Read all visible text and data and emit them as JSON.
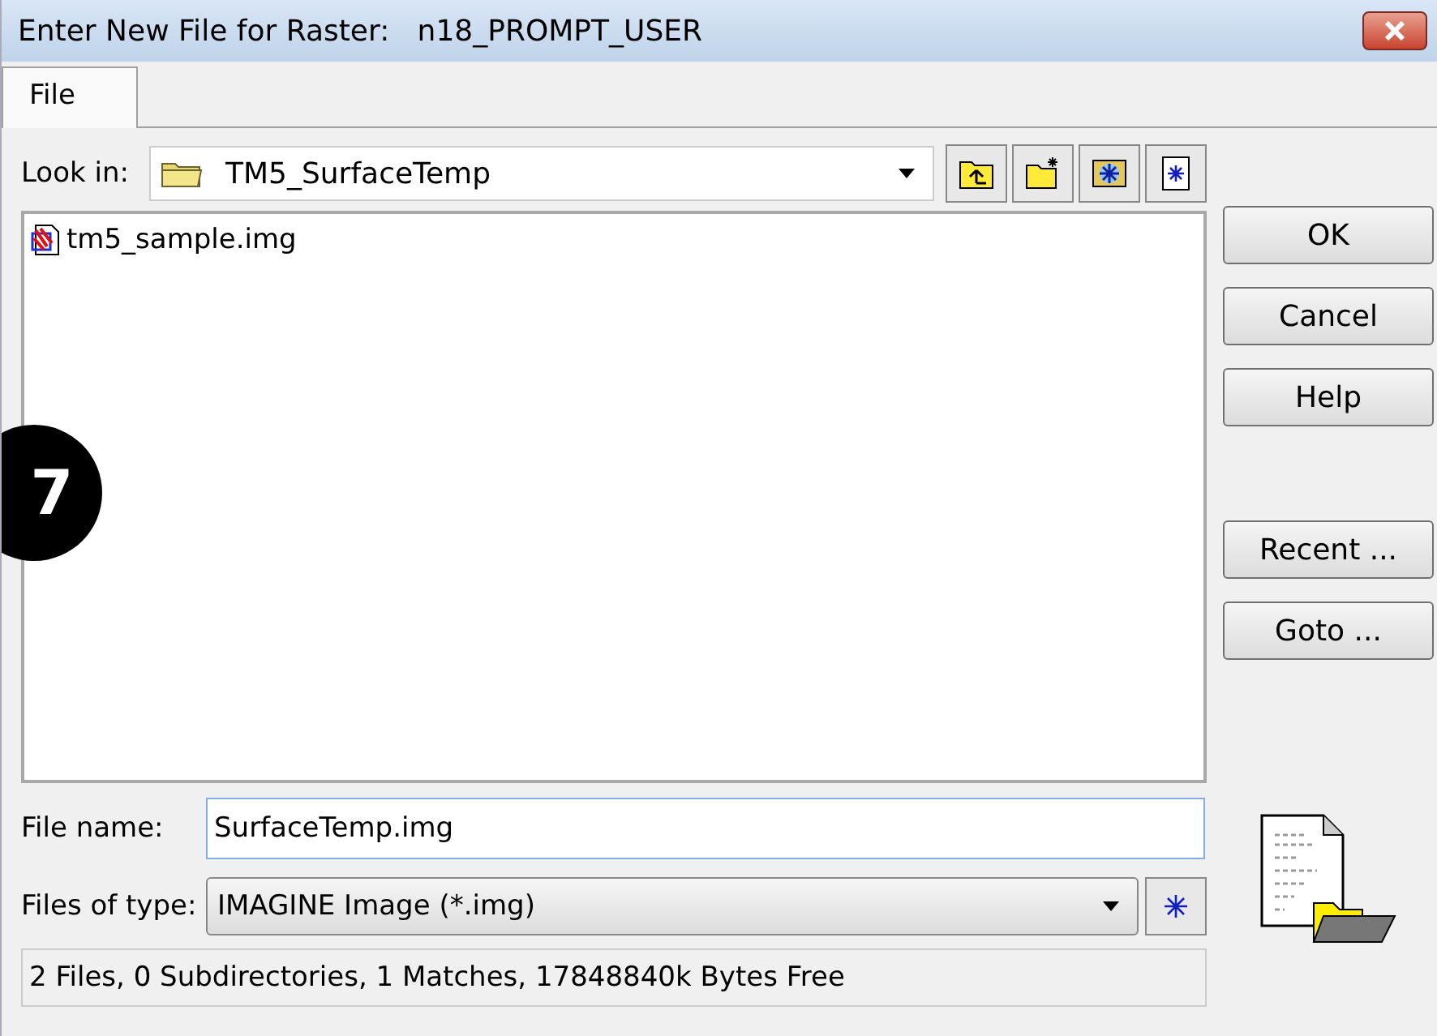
{
  "window": {
    "title": "Enter New File for Raster:   n18_PROMPT_USER"
  },
  "tabs": [
    {
      "label": "File",
      "selected": true
    }
  ],
  "look_in": {
    "label": "Look in:",
    "value": "TM5_SurfaceTemp"
  },
  "files": [
    {
      "name": "tm5_sample.img",
      "selected": false
    }
  ],
  "step_badge": "7",
  "buttons": [
    "OK",
    "Cancel",
    "Help",
    "Recent ...",
    "Goto ..."
  ],
  "file_name": {
    "label": "File name:",
    "value": "SurfaceTemp.img"
  },
  "file_type": {
    "label": "Files of type:",
    "value": "IMAGINE Image (*.img)"
  },
  "status_bar": "2 Files, 0 Subdirectories, 1 Matches, 17848840k Bytes Free"
}
